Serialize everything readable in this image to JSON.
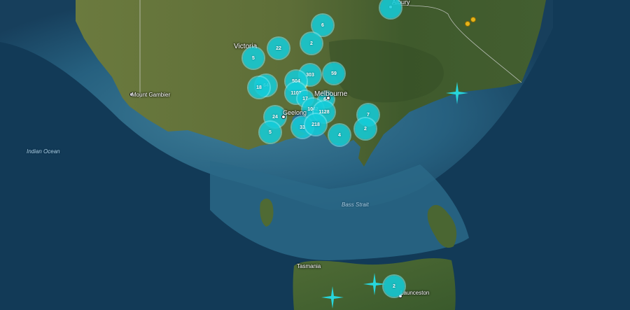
{
  "map": {
    "labels": {
      "albury": "Albury",
      "victoria": "Victoria",
      "mount_gambier": "Mount Gambier",
      "melbourne": "Melbourne",
      "geelong": "Geelong",
      "indian_ocean": "Indian Ocean",
      "bass_strait": "Bass Strait",
      "tasmania": "Tasmania",
      "launceston": "Launceston"
    },
    "clusters": [
      "6",
      "22",
      "2",
      "5",
      "59",
      "303",
      "504",
      "64",
      "18",
      "1107",
      "17",
      "64",
      "1042",
      "1128",
      "24",
      "5",
      "33",
      "218",
      "4",
      "7",
      "2",
      "2"
    ],
    "colors": {
      "ocean_deep": "#0f3350",
      "ocean_shelf": "#2c6b8c",
      "land": "#5c6d3a",
      "cluster": "#14cdda",
      "event": "#e6b31a",
      "star": "#27d6dc"
    }
  }
}
